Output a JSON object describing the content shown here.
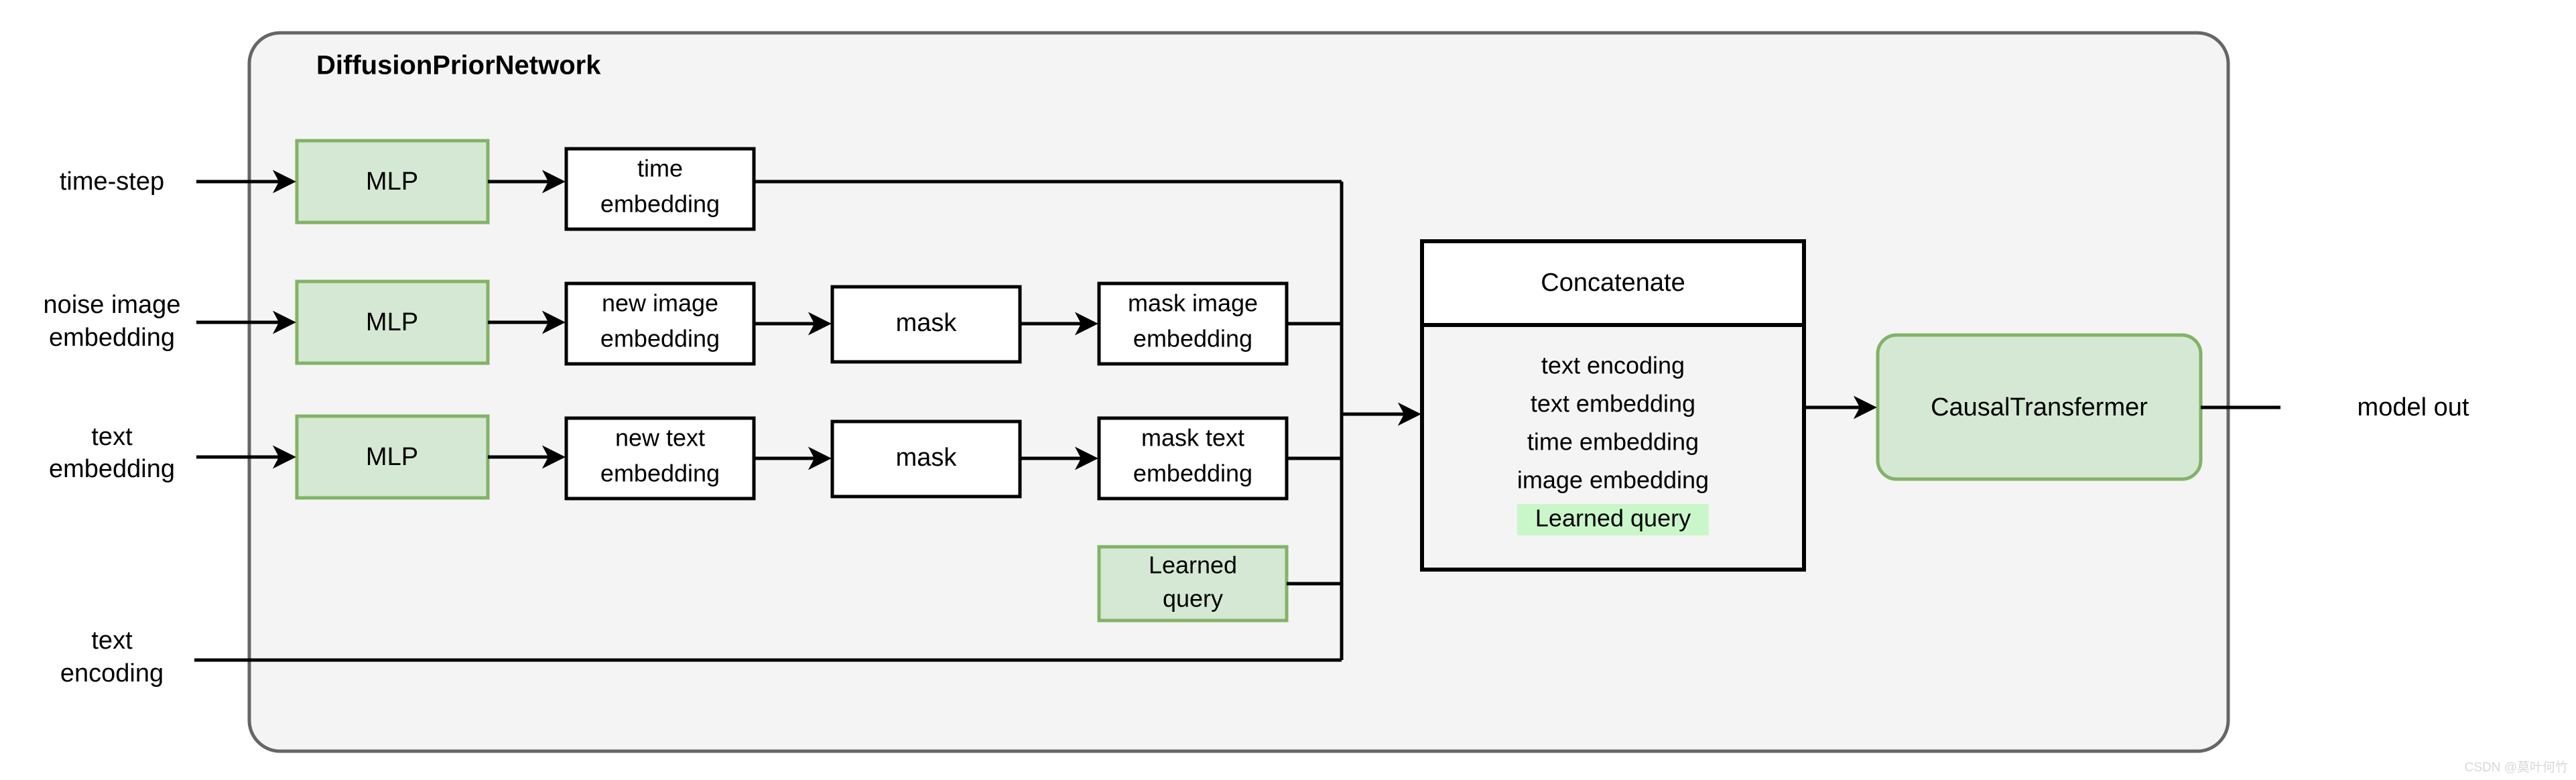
{
  "diagram": {
    "title": "DiffusionPriorNetwork",
    "container": {
      "label": "DiffusionPriorNetwork"
    },
    "inputs": [
      {
        "id": "time-step",
        "lines": [
          "time-step"
        ],
        "label": "time-step"
      },
      {
        "id": "noise-image-embedding",
        "lines": [
          "noise image",
          "embedding"
        ],
        "label": "noise image embedding"
      },
      {
        "id": "text-embedding",
        "lines": [
          "text",
          "embedding"
        ],
        "label": "text embedding"
      },
      {
        "id": "text-encoding",
        "lines": [
          "text",
          "encoding"
        ],
        "label": "text encoding"
      }
    ],
    "mlps": [
      {
        "id": "mlp-time",
        "label": "MLP"
      },
      {
        "id": "mlp-image",
        "label": "MLP"
      },
      {
        "id": "mlp-text",
        "label": "MLP"
      }
    ],
    "embeddings": [
      {
        "id": "time-embedding",
        "lines": [
          "time",
          "embedding"
        ],
        "label": "time embedding"
      },
      {
        "id": "new-image-embedding",
        "lines": [
          "new image",
          "embedding"
        ],
        "label": "new image embedding"
      },
      {
        "id": "new-text-embedding",
        "lines": [
          "new text",
          "embedding"
        ],
        "label": "new text embedding"
      }
    ],
    "masks": [
      {
        "id": "mask-image",
        "label": "mask"
      },
      {
        "id": "mask-text",
        "label": "mask"
      }
    ],
    "masked": [
      {
        "id": "mask-image-embedding",
        "lines": [
          "mask image",
          "embedding"
        ],
        "label": "mask image embedding"
      },
      {
        "id": "mask-text-embedding",
        "lines": [
          "mask text",
          "embedding"
        ],
        "label": "mask text embedding"
      }
    ],
    "learned_query_box": {
      "id": "learned-query",
      "lines": [
        "Learned",
        "query"
      ],
      "label": "Learned query"
    },
    "concatenate": {
      "header": "Concatenate",
      "items": [
        {
          "text": "text encoding",
          "highlight": false
        },
        {
          "text": "text embedding",
          "highlight": false
        },
        {
          "text": "time embedding",
          "highlight": false
        },
        {
          "text": "image embedding",
          "highlight": false
        },
        {
          "text": "Learned query",
          "highlight": true
        }
      ]
    },
    "transformer": {
      "id": "causal-transformer",
      "label": "CausalTransfermer"
    },
    "output": {
      "id": "model-out",
      "label": "model out"
    },
    "watermark": "CSDN @莫叶何竹",
    "colors": {
      "green_fill": "#d5e8d4",
      "green_stroke": "#82b366",
      "highlight_green": "#c9f7c9",
      "container_fill": "#f4f4f4",
      "container_stroke": "#666666",
      "wire": "#000000",
      "box_fill": "#ffffff",
      "page_bg": "#ffffff"
    }
  }
}
